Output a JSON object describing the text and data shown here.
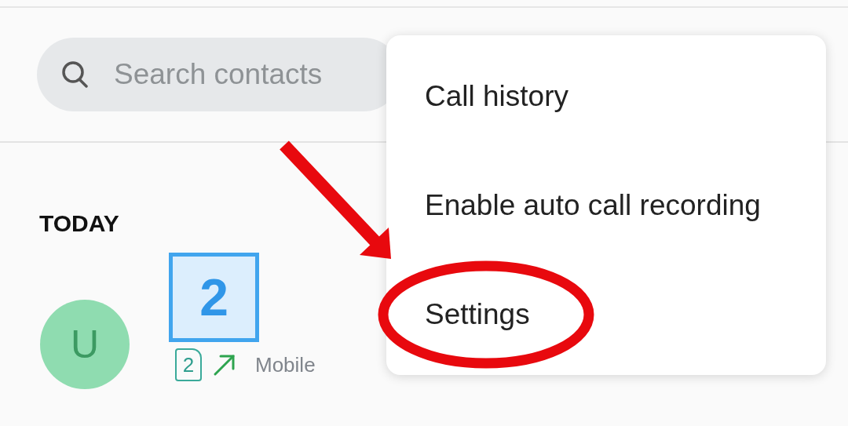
{
  "search": {
    "placeholder": "Search contacts"
  },
  "section": "TODAY",
  "calls": [
    {
      "avatar_letter": "U",
      "sim": "2",
      "kind": "outgoing",
      "number_type": "Mobile"
    }
  ],
  "annotation": {
    "step": "2"
  },
  "menu": [
    {
      "label": "Call history",
      "circled": false
    },
    {
      "label": "Enable auto call recording",
      "circled": false
    },
    {
      "label": "Settings",
      "circled": true
    }
  ]
}
